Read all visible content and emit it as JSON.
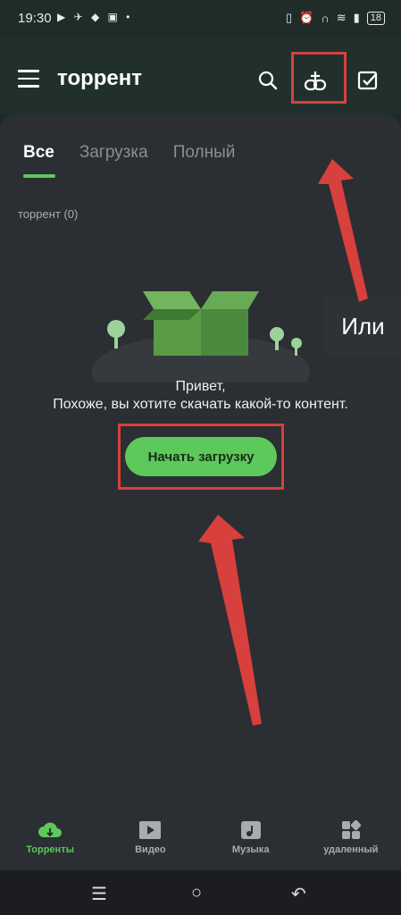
{
  "status_bar": {
    "time": "19:30",
    "left_icons": [
      "youtube-icon",
      "telegram-icon",
      "drop-icon",
      "gallery-icon",
      "dot-icon"
    ],
    "right_icons": [
      "vibrate-icon",
      "alarm-icon",
      "headphones-icon",
      "wifi-icon",
      "signal-icon"
    ],
    "battery": "18"
  },
  "app_bar": {
    "title": "торрент",
    "icons": [
      "menu-icon",
      "search-icon",
      "add-link-icon",
      "select-icon"
    ]
  },
  "tabs": [
    {
      "label": "Все",
      "active": true
    },
    {
      "label": "Загрузка",
      "active": false
    },
    {
      "label": "Полный",
      "active": false
    }
  ],
  "list": {
    "count_label": "торрент (0)"
  },
  "empty_state": {
    "line1": "Привет,",
    "line2": "Похоже, вы хотите скачать какой-то контент.",
    "button_label": "Начать загрузку"
  },
  "annotation": {
    "callout_text": "Или",
    "highlight_color": "#d7403c"
  },
  "bottom_nav": [
    {
      "label": "Торренты",
      "icon": "cloud-download-icon",
      "active": true
    },
    {
      "label": "Видео",
      "icon": "film-icon",
      "active": false
    },
    {
      "label": "Музыка",
      "icon": "music-icon",
      "active": false
    },
    {
      "label": "удаленный",
      "icon": "apps-icon",
      "active": false
    }
  ],
  "colors": {
    "accent": "#5cc95a",
    "panel": "#2b2e33",
    "appbar": "#21302d"
  }
}
